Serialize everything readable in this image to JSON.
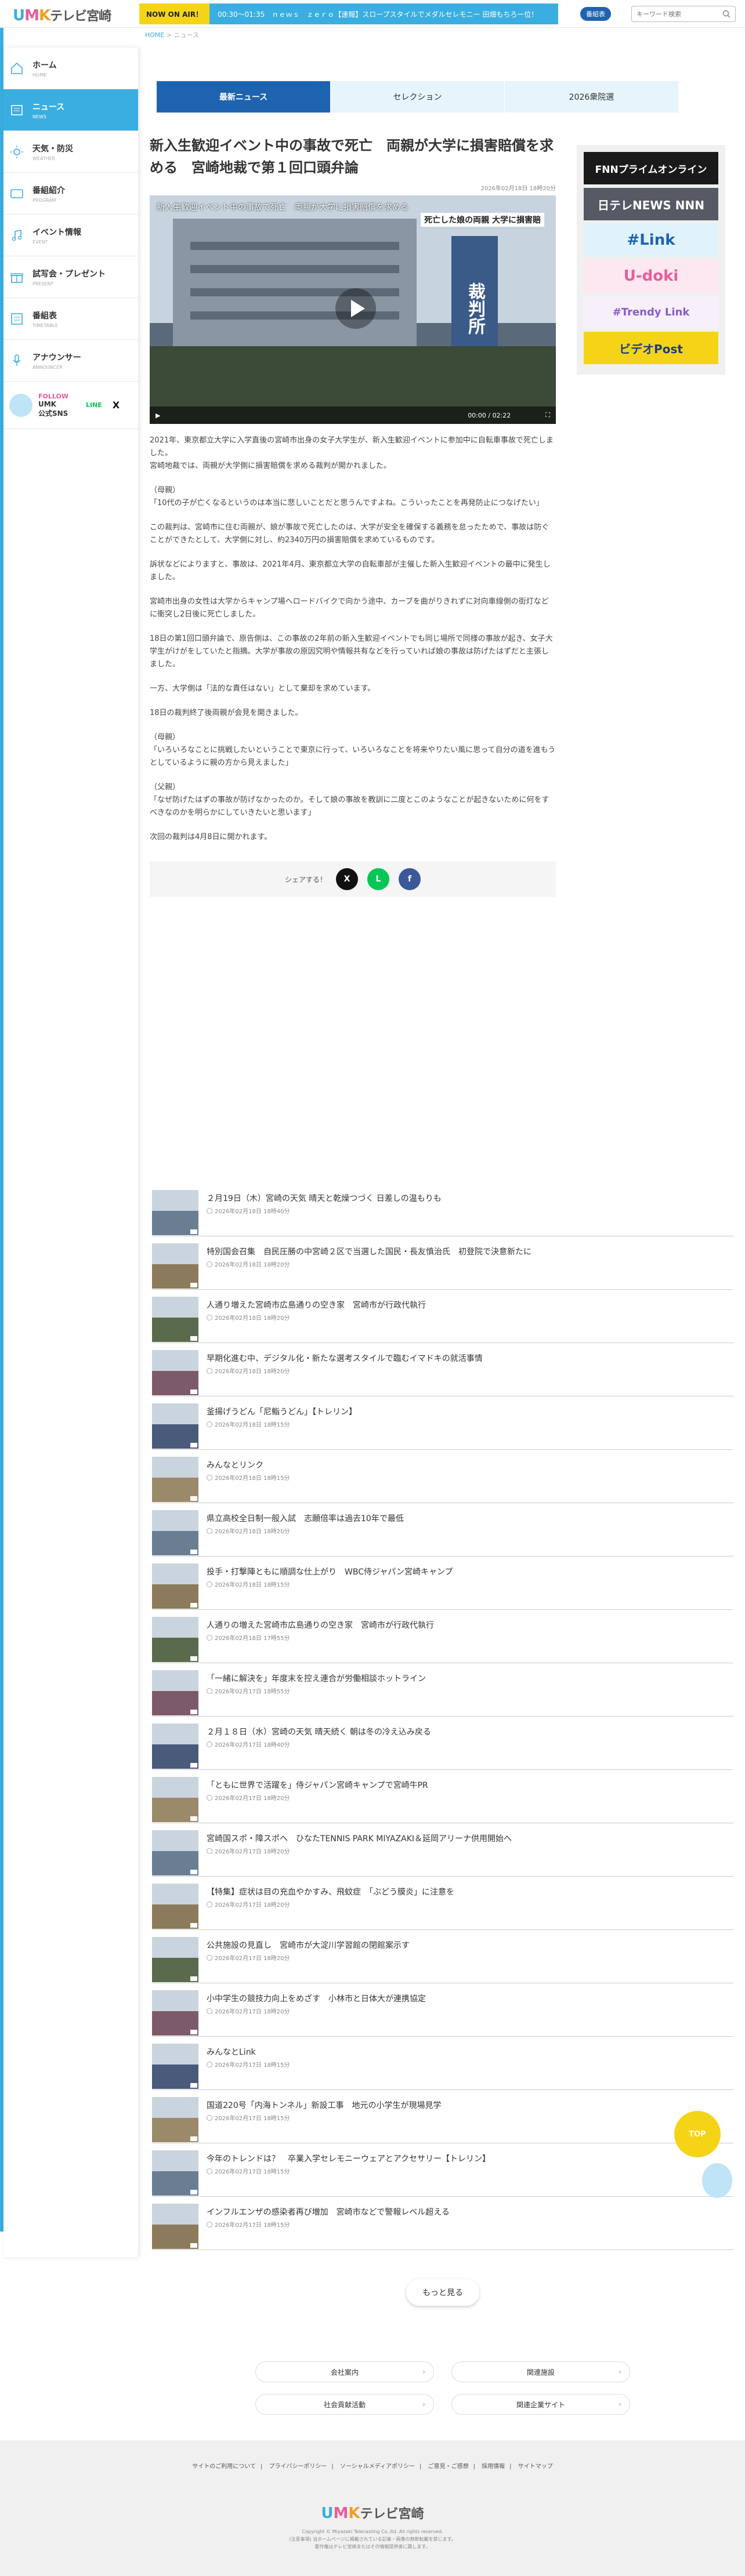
{
  "header": {
    "logo": {
      "u": "U",
      "m": "M",
      "k": "K",
      "jp": "テレビ宮崎"
    },
    "onair_tag": "NOW ON AIR！",
    "onair_text": "00:30〜01:35　ｎｅｗｓ　ｚｅｒｏ【速報】スロープスタイルでメダルセレモニー 田畑もちろー位！",
    "member_btn": "番組表",
    "search_placeholder": "キーワード検索"
  },
  "breadcrumb": {
    "home": "HOME",
    "sep": " > ",
    "current": "ニュース"
  },
  "sidebar": {
    "items": [
      {
        "ja": "ホーム",
        "en": "HOME",
        "icon": "home-icon"
      },
      {
        "ja": "ニュース",
        "en": "NEWS",
        "icon": "news-icon"
      },
      {
        "ja": "天気・防災",
        "en": "WEATHER",
        "icon": "sun-icon"
      },
      {
        "ja": "番組紹介",
        "en": "PROGRAM",
        "icon": "tv-icon"
      },
      {
        "ja": "イベント情報",
        "en": "EVENT",
        "icon": "music-icon"
      },
      {
        "ja": "試写会・プレゼント",
        "en": "PRESENT",
        "icon": "gift-icon"
      },
      {
        "ja": "番組表",
        "en": "TIMETABLE",
        "icon": "list-icon"
      },
      {
        "ja": "アナウンサー",
        "en": "ANNOUNCER",
        "icon": "mic-icon"
      }
    ],
    "follow": {
      "f1": "FOLLOW",
      "f2": "UMK",
      "f3": "公式SNS",
      "line": "LINE",
      "x": "X"
    }
  },
  "tabs": [
    "最新ニュース",
    "セレクション",
    "2026衆院選"
  ],
  "article": {
    "title": "新入生歓迎イベント中の事故で死亡　両親が大学に損害賠償を求める　宮崎地裁で第１回口頭弁論",
    "date": "2026年02月18日 18時20分",
    "video_caption": "新入生歓迎イベント中の事故で死亡　両親が大学に損害賠償を求める",
    "video_sub": "死亡した娘の両親 大学に損害賠",
    "video_sign": "裁判所",
    "video_time": "00:00 / 02:22",
    "paragraphs": [
      "2021年、東京都立大学に入学直後の宮崎市出身の女子大学生が、新入生歓迎イベントに参加中に自転車事故で死亡しました。\n宮崎地裁では、両親が大学側に損害賠償を求める裁判が開かれました。",
      "（母親）\n「10代の子が亡くなるというのは本当に悲しいことだと思うんですよね。こういったことを再発防止につなげたい」",
      "この裁判は、宮崎市に住む両親が、娘が事故で死亡したのは、大学が安全を確保する義務を怠ったためで、事故は防ぐことができたとして、大学側に対し、約2340万円の損害賠償を求めているものです。",
      "訴状などによりますと、事故は、2021年4月、東京都立大学の自転車部が主催した新入生歓迎イベントの最中に発生しました。",
      "宮崎市出身の女性は大学からキャンプ場へロードバイクで向かう途中、カーブを曲がりきれずに対向車線側の街灯などに衝突し2日後に死亡しました。",
      "18日の第1回口頭弁論で、原告側は、この事故の2年前の新入生歓迎イベントでも同じ場所で同様の事故が起き、女子大学生がけがをしていたと指摘。大学が事故の原因究明や情報共有などを行っていれば娘の事故は防げたはずだと主張しました。",
      "一方、大学側は「法的な責任はない」として棄却を求めています。",
      "18日の裁判終了後両親が会見を開きました。",
      "（母親）\n「いろいろなことに挑戦したいということで東京に行って、いろいろなことを将来やりたい風に思って自分の道を進もうとしているように親の方から見えました」",
      "（父親）\n「なぜ防げたはずの事故が防げなかったのか。そして娘の事故を教訓に二度とこのようなことが起きないために何をすべきなのかを明らかにしていきたいと思います」",
      "次回の裁判は4月8日に開かれます。"
    ],
    "share_label": "シェアする！",
    "share": [
      {
        "label": "X",
        "color": "#111111"
      },
      {
        "label": "L",
        "color": "#06c755"
      },
      {
        "label": "f",
        "color": "#3b5998"
      }
    ]
  },
  "banners": [
    {
      "text": "FNNプライムオンライン",
      "bg": "#1a1a1a",
      "fg": "#ffffff"
    },
    {
      "text": "日テレNEWS NNN",
      "bg": "#555a64",
      "fg": "#ffffff"
    },
    {
      "text": "#Link",
      "bg": "#e0f3fb",
      "fg": "#1e63b0"
    },
    {
      "text": "U-doki",
      "bg": "#fde7f0",
      "fg": "#e85c9c"
    },
    {
      "text": "#Trendy Link",
      "bg": "#f5f0fa",
      "fg": "#8a5cc4"
    },
    {
      "text": "ビデオPost",
      "bg": "#f5d418",
      "fg": "#1e3a88"
    }
  ],
  "news_list": [
    {
      "title": "２月19日（木）宮崎の天気 晴天と乾燥つづく 日差しの温もりも",
      "date": "2026年02月18日 18時40分"
    },
    {
      "title": "特別国会召集　自民圧勝の中宮崎２区で当選した国民・長友慎治氏　初登院で決意新たに",
      "date": "2026年02月18日 18時20分"
    },
    {
      "title": "人通り増えた宮崎市広島通りの空き家　宮崎市が行政代執行",
      "date": "2026年02月18日 18時20分"
    },
    {
      "title": "早期化進む中、デジタル化・新たな選考スタイルで臨むイマドキの就活事情",
      "date": "2026年02月18日 18時20分"
    },
    {
      "title": "釜揚げうどん「尼鮨うどん」【トレリン】",
      "date": "2026年02月18日 18時15分"
    },
    {
      "title": "みんなとリンク",
      "date": "2026年02月18日 18時15分"
    },
    {
      "title": "県立高校全日制一般入試　志願倍率は過去10年で最低",
      "date": "2026年02月18日 18時20分"
    },
    {
      "title": "投手・打撃陣ともに順調な仕上がり　WBC侍ジャパン宮崎キャンプ",
      "date": "2026年02月18日 18時15分"
    },
    {
      "title": "人通りの増えた宮崎市広島通りの空き家　宮崎市が行政代執行",
      "date": "2026年02月18日 17時55分"
    },
    {
      "title": "「一緒に解決を」年度末を控え連合が労働相談ホットライン",
      "date": "2026年02月17日 18時55分"
    },
    {
      "title": "２月１８日（水）宮崎の天気 晴天続く 朝は冬の冷え込み戻る",
      "date": "2026年02月17日 18時40分"
    },
    {
      "title": "「ともに世界で活躍を」侍ジャパン宮崎キャンプで宮崎牛PR",
      "date": "2026年02月17日 18時20分"
    },
    {
      "title": "宮崎国スポ・障スポへ　ひなたTENNIS PARK MIYAZAKI＆延岡アリーナ供用開始へ",
      "date": "2026年02月17日 18時20分"
    },
    {
      "title": "【特集】症状は目の充血やかすみ、飛蚊症　「ぶどう膜炎」に注意を",
      "date": "2026年02月17日 18時20分"
    },
    {
      "title": "公共施設の見直し　宮崎市が大淀川学習館の閉館案示す",
      "date": "2026年02月17日 18時20分"
    },
    {
      "title": "小中学生の競技力向上をめざす　小林市と日体大が連携協定",
      "date": "2026年02月17日 18時20分"
    },
    {
      "title": "みんなとLink",
      "date": "2026年02月17日 18時15分"
    },
    {
      "title": "国道220号「内海トンネル」新設工事　地元の小学生が現場見学",
      "date": "2026年02月17日 18時15分"
    },
    {
      "title": "今年のトレンドは？　卒業入学セレモニーウェアとアクセサリー【トレリン】",
      "date": "2026年02月17日 18時15分"
    },
    {
      "title": "インフルエンザの感染者再び増加　宮崎市などで警報レベル超える",
      "date": "2026年02月17日 18時15分"
    }
  ],
  "more_label": "もっと見る",
  "footer_links": [
    "会社案内",
    "関連施設",
    "社会貢献活動",
    "関連企業サイト"
  ],
  "footer_nav": [
    "サイトのご利用について",
    "プライバシーポリシー",
    "ソーシャルメディアポリシー",
    "ご意見・ご感想",
    "採用情報",
    "サイトマップ"
  ],
  "footer_logo": {
    "u": "U",
    "m": "M",
    "k": "K",
    "jp": "テレビ宮崎"
  },
  "copyright": "Copyright © Miyazaki Telecasting Co.,ltd. All rights reserved.",
  "copyright2": "(注意事項) 当ホームページに掲載されている記事・画像の無断転載を禁じます。",
  "copyright3": "著作権はテレビ宮崎またはその情報提供者に属します。",
  "top_label": "TOP"
}
